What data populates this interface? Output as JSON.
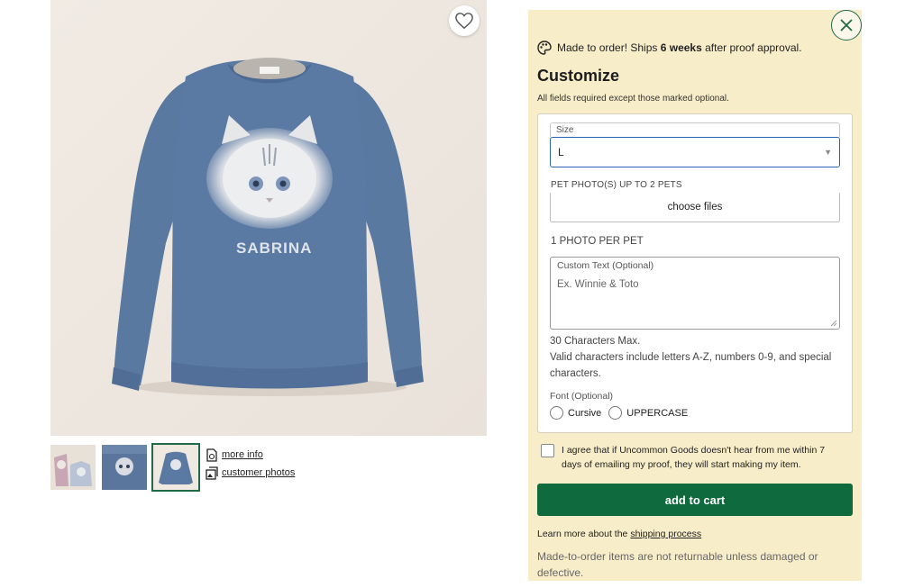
{
  "product": {
    "personalization_text": "SABRINA",
    "thumbnails": [
      {
        "name": "thumb-1",
        "active": false
      },
      {
        "name": "thumb-2",
        "active": false
      },
      {
        "name": "thumb-3",
        "active": true
      }
    ],
    "links": {
      "more_info": "more info",
      "customer_photos": "customer photos"
    }
  },
  "customize": {
    "ship_prefix": "Made to order! Ships ",
    "ship_weeks": "6 weeks",
    "ship_suffix": " after proof approval.",
    "title": "Customize",
    "required_note": "All fields required except those marked optional.",
    "size": {
      "label": "Size",
      "value": "L"
    },
    "pet_photo": {
      "label": "PET PHOTO(S) UP TO 2 PETS",
      "button": "choose files",
      "note": "1 PHOTO PER PET"
    },
    "custom_text": {
      "label": "Custom Text (Optional)",
      "placeholder": "Ex. Winnie & Toto",
      "max_note": "30 Characters Max.",
      "valid_note": "Valid characters include letters A-Z, numbers 0-9, and special characters."
    },
    "font": {
      "label": "Font (Optional)",
      "options": [
        "Cursive",
        "UPPERCASE"
      ]
    },
    "agree_text": "I agree that if Uncommon Goods doesn't hear from me within 7 days of emailing my proof, they will start making my item.",
    "add_to_cart": "add to cart",
    "learn_prefix": "Learn more about the ",
    "learn_link": "shipping process",
    "return_note": "Made-to-order items are not returnable unless damaged or defective."
  },
  "colors": {
    "panel_bg": "#f8edc9",
    "accent_green": "#0f6a3e",
    "sweater_blue": "#5b7aa3",
    "select_focus": "#2a63b8"
  }
}
